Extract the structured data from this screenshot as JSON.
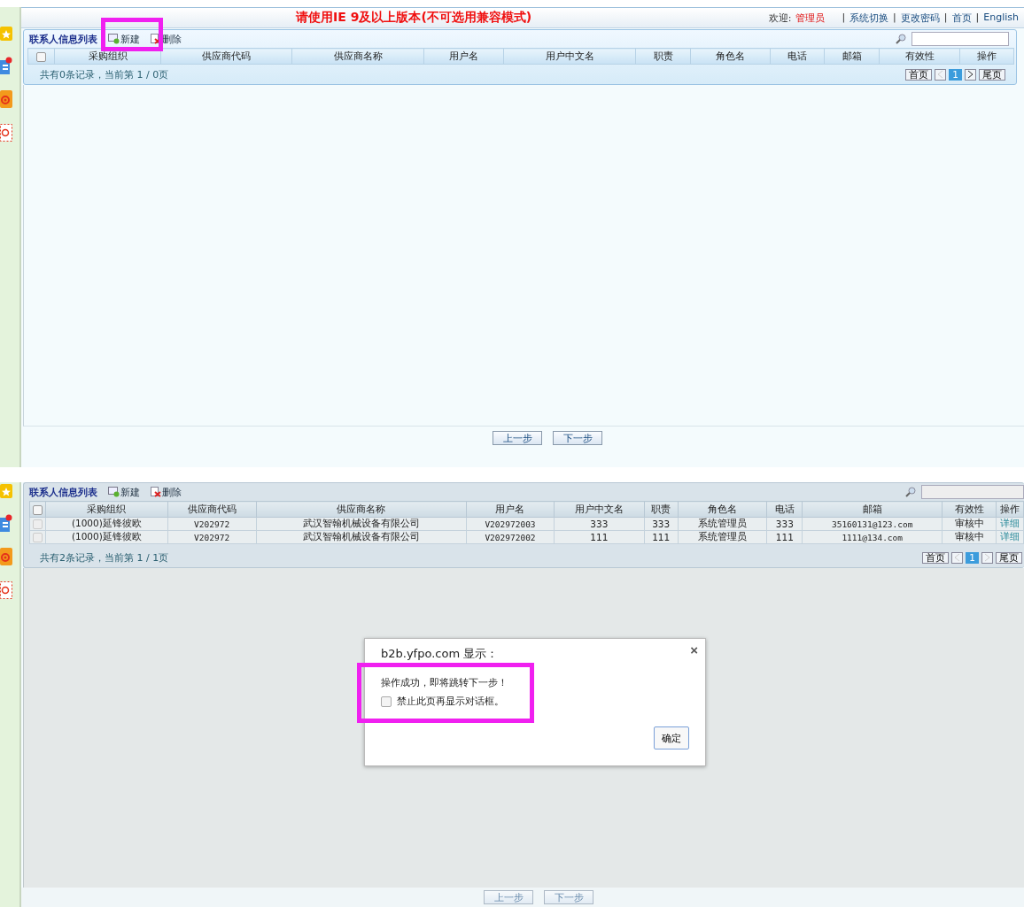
{
  "top_screen": {
    "notice": "请使用IE 9及以上版本(不可选用兼容模式)",
    "nav": [
      {
        "kind": "label",
        "label": "欢迎:"
      },
      {
        "kind": "user",
        "label": "管理员"
      },
      {
        "kind": "separator",
        "label": "|"
      },
      {
        "kind": "link",
        "label": "系统切换"
      },
      {
        "kind": "separator",
        "label": "|"
      },
      {
        "kind": "link",
        "label": "更改密码"
      },
      {
        "kind": "separator",
        "label": "|"
      },
      {
        "kind": "link",
        "label": "首页"
      },
      {
        "kind": "separator",
        "label": "|"
      },
      {
        "kind": "link",
        "label": "English"
      }
    ],
    "grid": {
      "title": "联系人信息列表",
      "toolbar": [
        {
          "kind": "add",
          "label": "新建"
        },
        {
          "kind": "delete",
          "label": "删除"
        }
      ],
      "select_all_checked": false,
      "columns": [
        "采购组织",
        "供应商代码",
        "供应商名称",
        "用户名",
        "用户中文名",
        "职责",
        "角色名",
        "电话",
        "邮箱",
        "有效性",
        "操作"
      ],
      "summary": "共有0条记录，当前第 1 / 0页",
      "pager": {
        "first": "首页",
        "page": "1",
        "last": "尾页",
        "prev_disabled": true,
        "next_disabled": false
      }
    },
    "buttons": [
      "上一步",
      "下一步"
    ]
  },
  "bottom_screen": {
    "grid": {
      "title": "联系人信息列表",
      "toolbar": [
        {
          "kind": "add",
          "label": "新建"
        },
        {
          "kind": "delete",
          "label": "删除"
        }
      ],
      "select_all_checked": false,
      "columns": [
        "采购组织",
        "供应商代码",
        "供应商名称",
        "用户名",
        "用户中文名",
        "职责",
        "角色名",
        "电话",
        "邮箱",
        "有效性",
        "操作"
      ],
      "rows": [
        {
          "checked": false,
          "cells": [
            "(1000)延锋彼欧",
            "V202972",
            "武汉智翰机械设备有限公司",
            "V202972003",
            "333",
            "333",
            "系统管理员",
            "333",
            "35160131@123.com",
            "审核中",
            "详细"
          ]
        },
        {
          "checked": false,
          "cells": [
            "(1000)延锋彼欧",
            "V202972",
            "武汉智翰机械设备有限公司",
            "V202972002",
            "111",
            "111",
            "系统管理员",
            "111",
            "1111@134.com",
            "审核中",
            "详细"
          ]
        }
      ],
      "summary": "共有2条记录，当前第 1 / 1页",
      "pager": {
        "first": "首页",
        "page": "1",
        "last": "尾页",
        "prev_disabled": true,
        "next_disabled": true
      }
    },
    "dialog": {
      "title": "b2b.yfpo.com 显示：",
      "close": "×",
      "message": "操作成功，即将跳转下一步！",
      "suppress_label": "禁止此页再显示对话框。",
      "suppress_checked": false,
      "ok": "确定"
    },
    "buttons": [
      "上一步",
      "下一步"
    ]
  }
}
